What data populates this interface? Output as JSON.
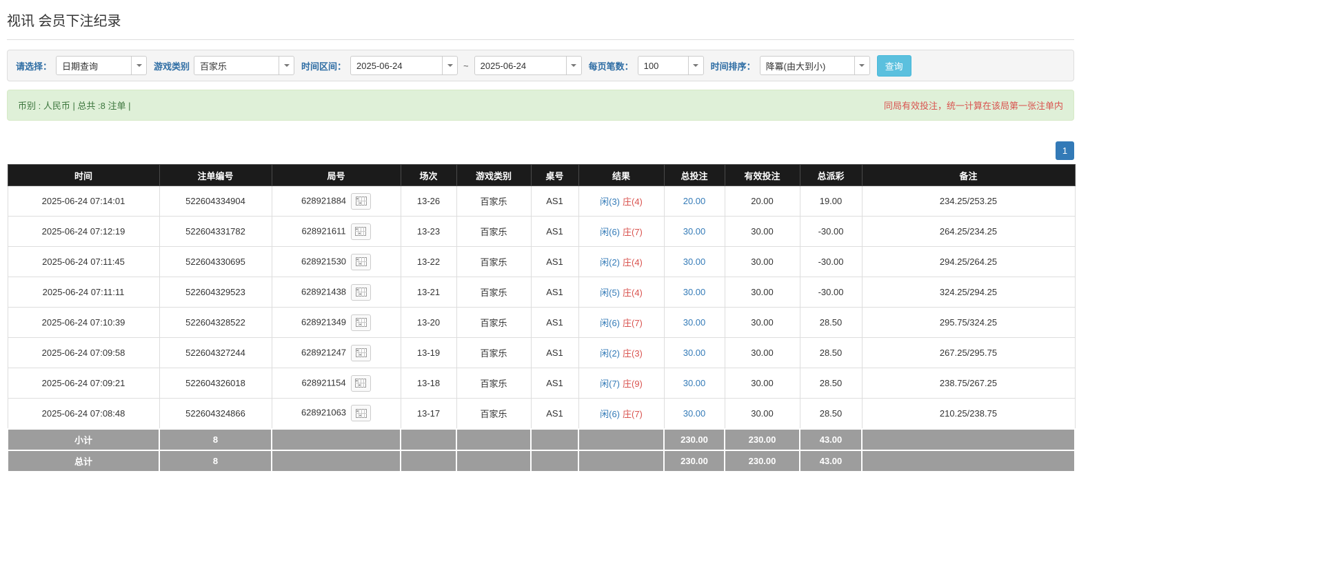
{
  "page": {
    "title": "视讯 会员下注纪录"
  },
  "filters": {
    "query_type": {
      "label": "请选择：",
      "value": "日期查询"
    },
    "game_type": {
      "label": "游戏类别",
      "value": "百家乐"
    },
    "time_range": {
      "label": "时间区间：",
      "from": "2025-06-24",
      "separator": "~",
      "to": "2025-06-24"
    },
    "page_size": {
      "label": "每页笔数：",
      "value": "100"
    },
    "sort": {
      "label": "时间排序：",
      "value": "降冪(由大到小)"
    },
    "search_button": "查询"
  },
  "notice": {
    "currency_summary": "币别 : 人民币 | 总共 :8 注单 |",
    "warning": "同局有效投注，统一计算在该局第一张注单内"
  },
  "pagination": {
    "current_page": "1"
  },
  "table": {
    "headers": [
      "时间",
      "注单编号",
      "局号",
      "场次",
      "游戏类别",
      "桌号",
      "结果",
      "总投注",
      "有效投注",
      "总派彩",
      "备注"
    ],
    "rows": [
      {
        "time": "2025-06-24 07:14:01",
        "bet_id": "522604334904",
        "round": "628921884",
        "session": "13-26",
        "game": "百家乐",
        "table_no": "AS1",
        "result_player": "闲(3)",
        "result_banker": "庄(4)",
        "total_bet": "20.00",
        "valid_bet": "20.00",
        "payout": "19.00",
        "note": "234.25/253.25"
      },
      {
        "time": "2025-06-24 07:12:19",
        "bet_id": "522604331782",
        "round": "628921611",
        "session": "13-23",
        "game": "百家乐",
        "table_no": "AS1",
        "result_player": "闲(6)",
        "result_banker": "庄(7)",
        "total_bet": "30.00",
        "valid_bet": "30.00",
        "payout": "-30.00",
        "note": "264.25/234.25"
      },
      {
        "time": "2025-06-24 07:11:45",
        "bet_id": "522604330695",
        "round": "628921530",
        "session": "13-22",
        "game": "百家乐",
        "table_no": "AS1",
        "result_player": "闲(2)",
        "result_banker": "庄(4)",
        "total_bet": "30.00",
        "valid_bet": "30.00",
        "payout": "-30.00",
        "note": "294.25/264.25"
      },
      {
        "time": "2025-06-24 07:11:11",
        "bet_id": "522604329523",
        "round": "628921438",
        "session": "13-21",
        "game": "百家乐",
        "table_no": "AS1",
        "result_player": "闲(5)",
        "result_banker": "庄(4)",
        "total_bet": "30.00",
        "valid_bet": "30.00",
        "payout": "-30.00",
        "note": "324.25/294.25"
      },
      {
        "time": "2025-06-24 07:10:39",
        "bet_id": "522604328522",
        "round": "628921349",
        "session": "13-20",
        "game": "百家乐",
        "table_no": "AS1",
        "result_player": "闲(6)",
        "result_banker": "庄(7)",
        "total_bet": "30.00",
        "valid_bet": "30.00",
        "payout": "28.50",
        "note": "295.75/324.25"
      },
      {
        "time": "2025-06-24 07:09:58",
        "bet_id": "522604327244",
        "round": "628921247",
        "session": "13-19",
        "game": "百家乐",
        "table_no": "AS1",
        "result_player": "闲(2)",
        "result_banker": "庄(3)",
        "total_bet": "30.00",
        "valid_bet": "30.00",
        "payout": "28.50",
        "note": "267.25/295.75"
      },
      {
        "time": "2025-06-24 07:09:21",
        "bet_id": "522604326018",
        "round": "628921154",
        "session": "13-18",
        "game": "百家乐",
        "table_no": "AS1",
        "result_player": "闲(7)",
        "result_banker": "庄(9)",
        "total_bet": "30.00",
        "valid_bet": "30.00",
        "payout": "28.50",
        "note": "238.75/267.25"
      },
      {
        "time": "2025-06-24 07:08:48",
        "bet_id": "522604324866",
        "round": "628921063",
        "session": "13-17",
        "game": "百家乐",
        "table_no": "AS1",
        "result_player": "闲(6)",
        "result_banker": "庄(7)",
        "total_bet": "30.00",
        "valid_bet": "30.00",
        "payout": "28.50",
        "note": "210.25/238.75"
      }
    ],
    "subtotal": {
      "label": "小计",
      "count": "8",
      "total_bet": "230.00",
      "valid_bet": "230.00",
      "payout": "43.00"
    },
    "grand_total": {
      "label": "总计",
      "count": "8",
      "total_bet": "230.00",
      "valid_bet": "230.00",
      "payout": "43.00"
    }
  },
  "colors": {
    "accent_blue": "#337ab7",
    "danger_red": "#d9534f",
    "info_button": "#5bc0de",
    "notice_bg": "#dff0d8",
    "table_header_bg": "#1b1b1b",
    "table_footer_bg": "#9d9d9d"
  }
}
